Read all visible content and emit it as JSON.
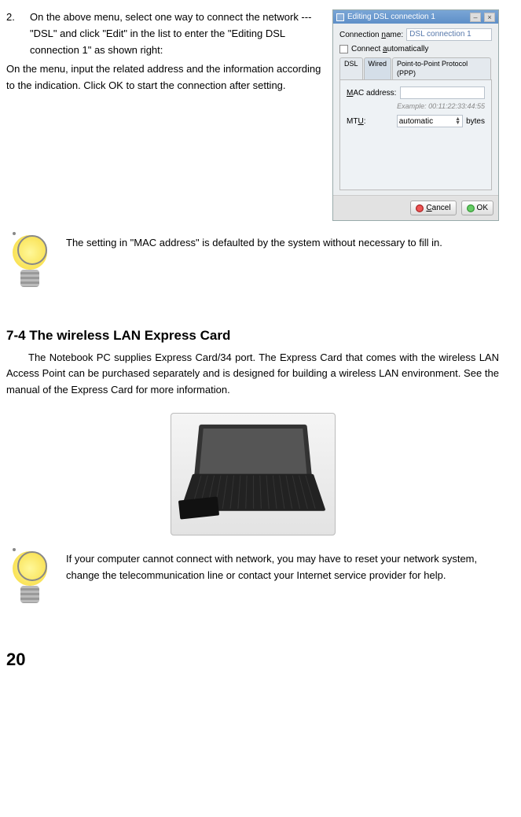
{
  "step": {
    "num": "2.",
    "text": "On the above menu, select one way to connect the network ---\"DSL\" and click \"Edit\" in the list to enter the \"Editing DSL connection 1\" as shown right:"
  },
  "after_step": "On the menu, input the related address and the information according to the indication. Click OK to start the connection after setting.",
  "tip1": "The setting in \"MAC address\" is defaulted by the system without necessary to fill in.",
  "heading": "7-4 The wireless LAN Express Card",
  "body": "The Notebook PC supplies Express Card/34 port. The Express Card that comes with the wireless LAN Access Point can be purchased separately and is designed for building a wireless LAN environment. See the manual of the Express Card for more information.",
  "tip2": "If your computer cannot connect with network, you may have to reset your network system, change the telecommunication line or contact your Internet service provider for help.",
  "page": "20",
  "dialog": {
    "title": "Editing DSL connection 1",
    "name_label": "Connection name:",
    "name_value": "DSL connection 1",
    "auto_label": "Connect automatically",
    "tabs": {
      "dsl": "DSL",
      "wired": "Wired",
      "ppp": "Point-to-Point Protocol (PPP)"
    },
    "mac_label": "MAC address:",
    "mac_example": "Example: 00:11:22:33:44:55",
    "mtu_label": "MTU:",
    "mtu_value": "automatic",
    "mtu_unit": "bytes",
    "cancel": "Cancel",
    "ok": "OK"
  }
}
